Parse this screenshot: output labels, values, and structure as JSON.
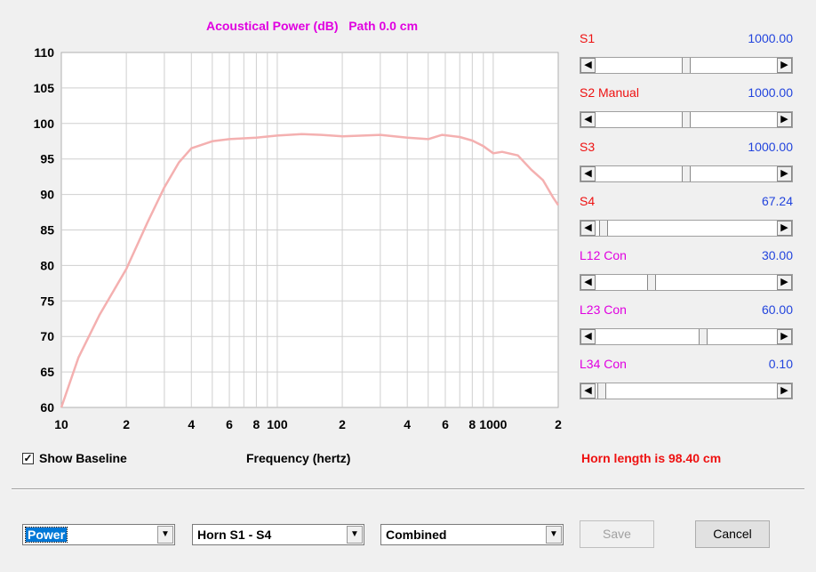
{
  "chart": {
    "title": "Acoustical Power (dB)   Path 0.0 cm",
    "xlabel": "Frequency (hertz)"
  },
  "chart_data": {
    "type": "line",
    "title": "Acoustical Power (dB)   Path 0.0 cm",
    "xlabel": "Frequency (hertz)",
    "ylabel": "",
    "xscale": "log",
    "xlim": [
      10,
      2000
    ],
    "ylim": [
      60,
      110
    ],
    "grid": true,
    "y_ticks": [
      "110",
      "105",
      "100",
      "95",
      "90",
      "85",
      "80",
      "75",
      "70",
      "65",
      "60"
    ],
    "x_ticks": [
      "10",
      "2",
      "4",
      "6",
      "8",
      "100",
      "2",
      "4",
      "6",
      "8",
      "1000",
      "2"
    ],
    "series": [
      {
        "color": "#f4b0b0",
        "x": [
          10,
          12,
          15,
          20,
          25,
          30,
          35,
          40,
          50,
          60,
          80,
          100,
          130,
          160,
          200,
          250,
          300,
          400,
          500,
          580,
          700,
          800,
          900,
          1000,
          1100,
          1300,
          1500,
          1700,
          1900,
          2000
        ],
        "y": [
          60,
          67,
          73,
          79.5,
          86,
          91,
          94.5,
          96.5,
          97.5,
          97.8,
          98,
          98.3,
          98.5,
          98.4,
          98.2,
          98.3,
          98.4,
          98,
          97.8,
          98.4,
          98.1,
          97.6,
          96.8,
          95.8,
          96,
          95.5,
          93.5,
          92,
          89.5,
          88.5
        ]
      }
    ]
  },
  "sliders": [
    {
      "label": "S1",
      "value": "1000.00",
      "label_color": "#ee1111",
      "position": 0.5
    },
    {
      "label": "S2 Manual",
      "value": "1000.00",
      "label_color": "#ee1111",
      "position": 0.5
    },
    {
      "label": "S3",
      "value": "1000.00",
      "label_color": "#ee1111",
      "position": 0.5
    },
    {
      "label": "S4",
      "value": "67.24",
      "label_color": "#ee1111",
      "position": 0.02
    },
    {
      "label": "L12  Con",
      "value": "30.00",
      "label_color": "#e000e0",
      "position": 0.3
    },
    {
      "label": "L23  Con",
      "value": "60.00",
      "label_color": "#e000e0",
      "position": 0.6
    },
    {
      "label": "L34  Con",
      "value": "0.10",
      "label_color": "#e000e0",
      "position": 0.01
    }
  ],
  "show_baseline": {
    "label": "Show Baseline",
    "checked": true,
    "check_glyph": "✓"
  },
  "horn_length": {
    "text": "Horn length is 98.40 cm",
    "color": "#ee1111"
  },
  "dropdowns": [
    {
      "value": "Power"
    },
    {
      "value": "Horn S1 - S4"
    },
    {
      "value": "Combined"
    }
  ],
  "buttons": {
    "save": "Save",
    "cancel": "Cancel"
  }
}
